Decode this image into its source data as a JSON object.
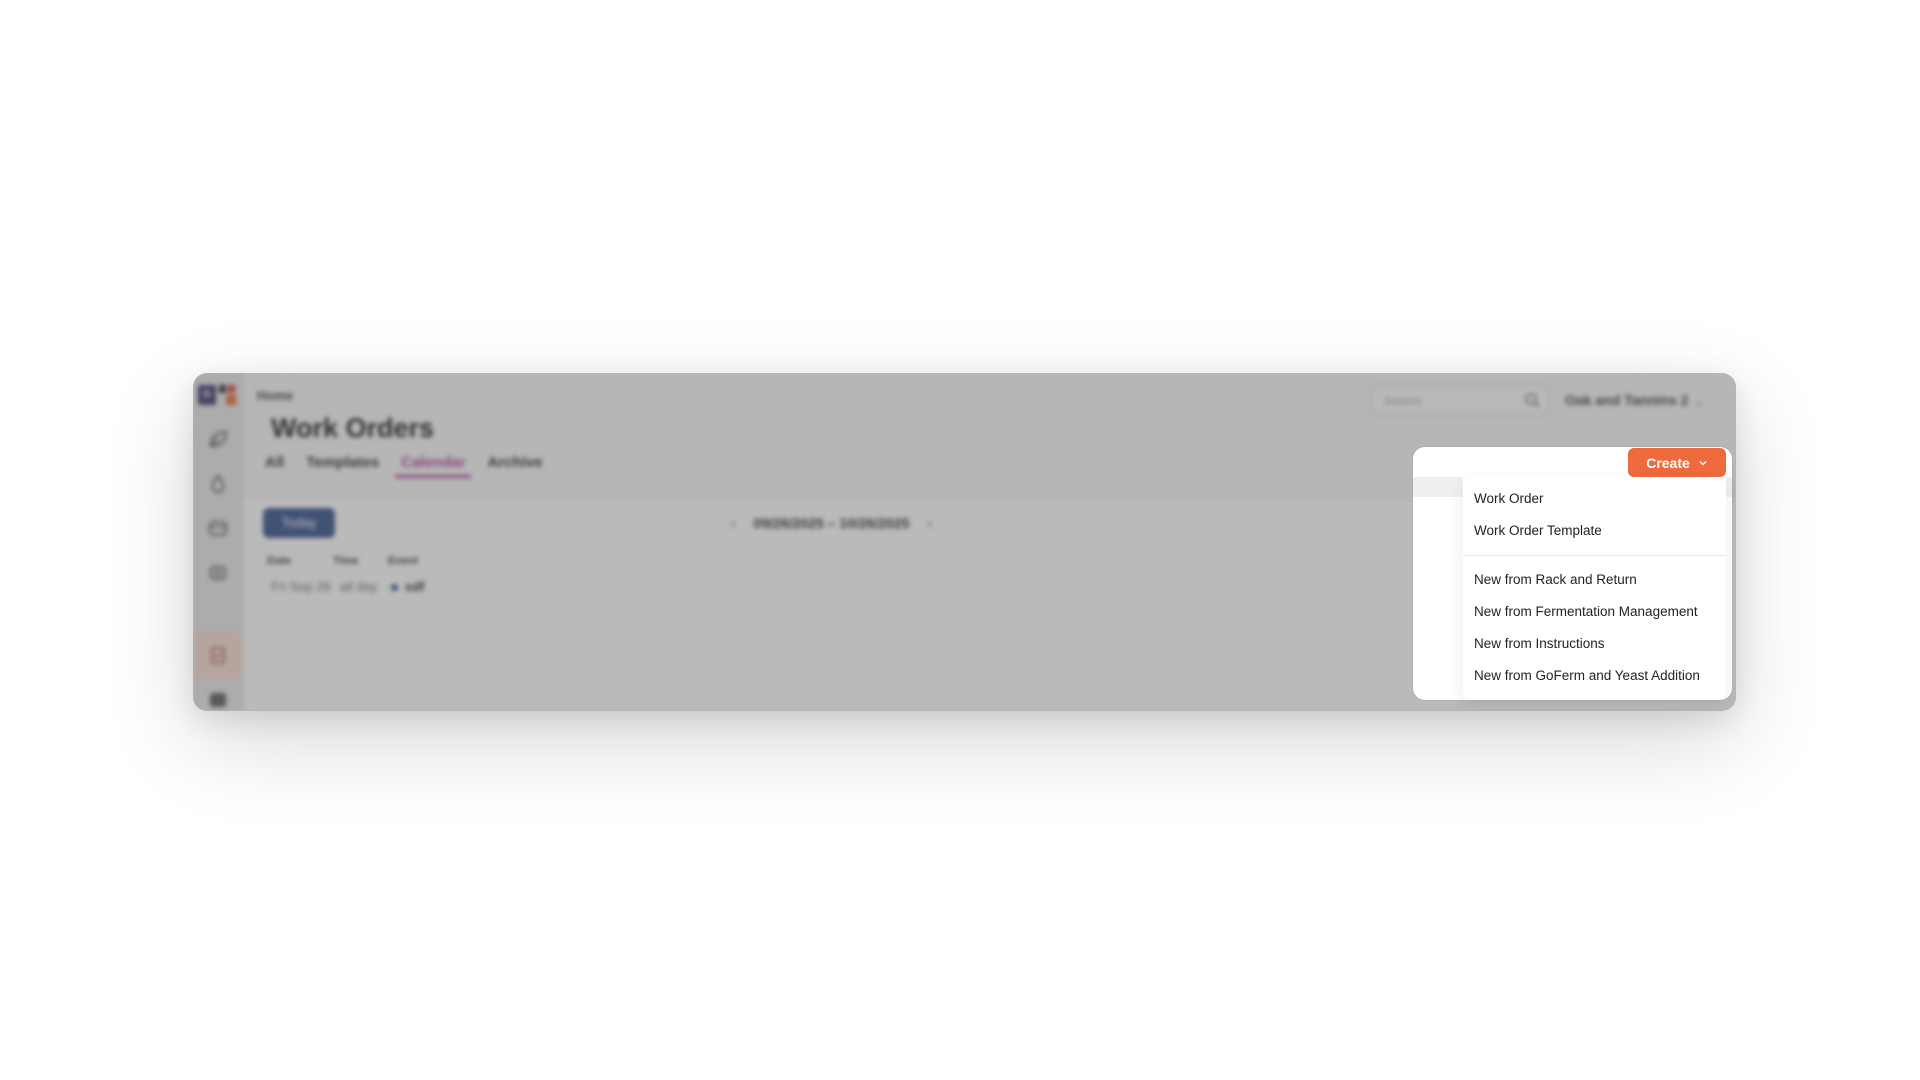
{
  "app": {
    "breadcrumb": "Home",
    "title": "Work Orders",
    "tabs": [
      {
        "label": "All"
      },
      {
        "label": "Templates"
      },
      {
        "label": "Calendar"
      },
      {
        "label": "Archive"
      }
    ],
    "active_tab": "Calendar",
    "search_placeholder": "Search",
    "account_name": "Oak and Tannins 2"
  },
  "calendar": {
    "today_label": "Today",
    "date_range": "09/26/2025 – 10/26/2025",
    "columns": {
      "date": "Date",
      "time": "Time",
      "event": "Event"
    },
    "rows": [
      {
        "date": "Fri Sep 26",
        "time": "all day",
        "event": "sdf"
      }
    ]
  },
  "create_menu": {
    "button_label": "Create",
    "group1": [
      {
        "label": "Work Order"
      },
      {
        "label": "Work Order Template"
      }
    ],
    "group2": [
      {
        "label": "New from Rack and Return"
      },
      {
        "label": "New from Fermentation Management"
      },
      {
        "label": "New from Instructions"
      },
      {
        "label": "New from GoFerm and Yeast Addition"
      }
    ]
  },
  "colors": {
    "accent_orange": "#ef6a3d",
    "active_tab": "#a5359a",
    "primary_blue": "#2c4a86"
  }
}
